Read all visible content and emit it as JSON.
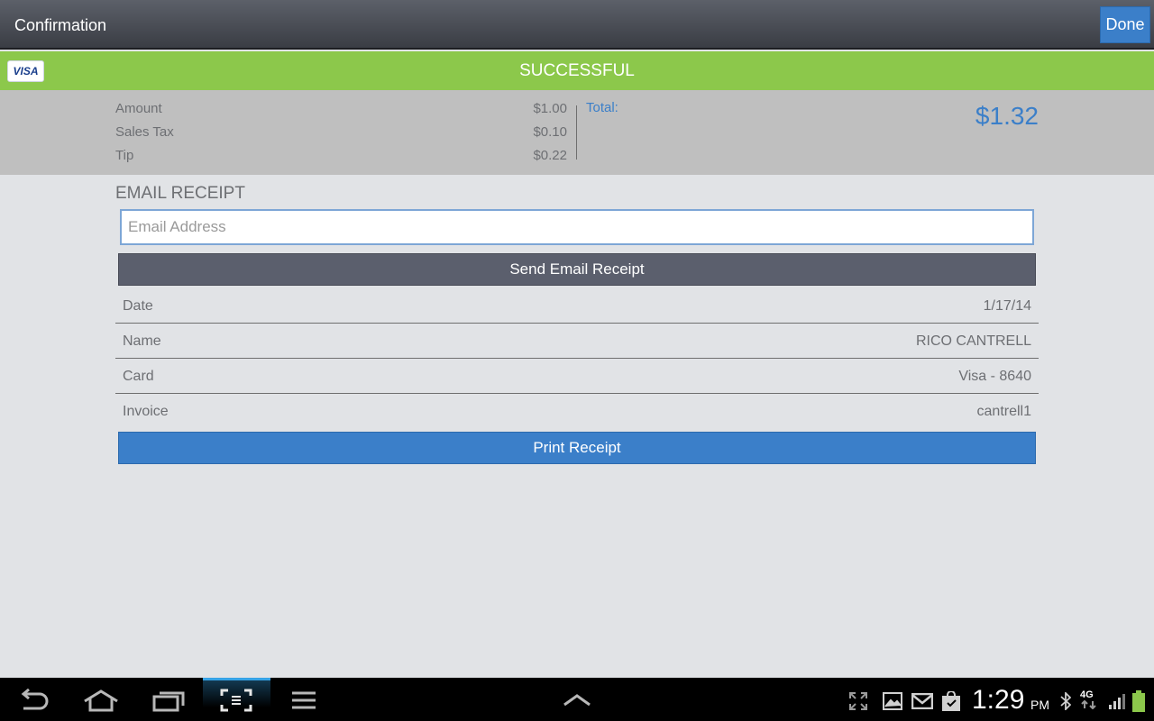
{
  "action_bar": {
    "title": "Confirmation",
    "done_label": "Done"
  },
  "status": {
    "card_brand": "VISA",
    "message": "SUCCESSFUL"
  },
  "summary": {
    "rows": [
      {
        "label": "Amount",
        "value": "$1.00"
      },
      {
        "label": "Sales Tax",
        "value": "$0.10"
      },
      {
        "label": "Tip",
        "value": "$0.22"
      }
    ],
    "total_label": "Total:",
    "total_value": "$1.32"
  },
  "email": {
    "heading": "EMAIL RECEIPT",
    "placeholder": "Email Address",
    "value": "",
    "send_label": "Send Email Receipt"
  },
  "details": [
    {
      "label": "Date",
      "value": "1/17/14"
    },
    {
      "label": "Name",
      "value": "RICO CANTRELL"
    },
    {
      "label": "Card",
      "value": "Visa - 8640"
    },
    {
      "label": "Invoice",
      "value": "cantrell1"
    }
  ],
  "print_label": "Print Receipt",
  "system_bar": {
    "time": "1:29",
    "ampm": "PM",
    "network": "4G",
    "nav_icons": [
      "back-icon",
      "home-icon",
      "recent-apps-icon",
      "screenshot-icon",
      "menu-icon",
      "chevron-up-icon"
    ],
    "tray_icons": [
      "fullscreen-icon",
      "gallery-icon",
      "gmail-icon",
      "play-store-icon",
      "bluetooth-icon",
      "signal-icon",
      "battery-icon"
    ],
    "accent_color": "#36a3e6"
  },
  "colors": {
    "success": "#8cc84b",
    "primary": "#3b7fc9",
    "send_button": "#5b5f6d"
  }
}
